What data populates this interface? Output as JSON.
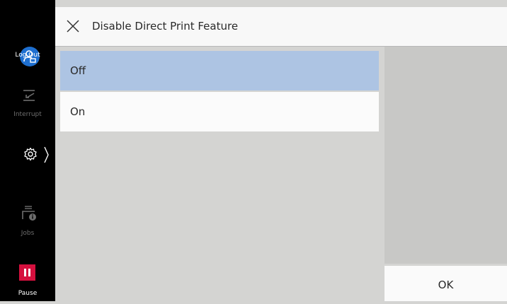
{
  "sidebar": {
    "logout_label": "Log Out",
    "interrupt_label": "Interrupt",
    "jobs_label": "Jobs",
    "pause_label": "Pause",
    "accent_color": "#1e6fd0",
    "pause_color": "#d5103e"
  },
  "header": {
    "title": "Disable Direct Print Feature",
    "close_icon": "close-icon"
  },
  "options": [
    {
      "label": "Off",
      "selected": true
    },
    {
      "label": "On",
      "selected": false
    }
  ],
  "footer": {
    "ok_label": "OK"
  }
}
